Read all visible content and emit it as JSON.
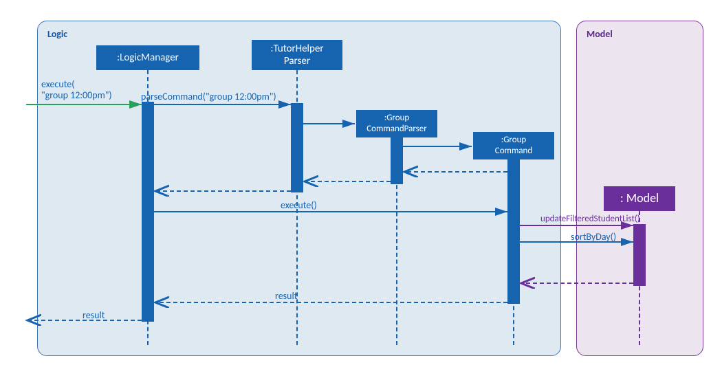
{
  "containers": {
    "logic_label": "Logic",
    "model_label": "Model"
  },
  "participants": {
    "logic_manager": ":LogicManager",
    "tutor_helper_parser": ":TutorHelper\nParser",
    "group_command_parser": ":Group\nCommandParser",
    "group_command": ":Group\nCommand",
    "model": ":   Model"
  },
  "messages": {
    "external_execute": "execute(\n\"group 12:00pm\")",
    "parse_command": "parseCommand(\"group 12:00pm\")",
    "execute": "execute()",
    "update_filtered": "updateFilteredStudentList()",
    "sort_by_day": "sortByDay()",
    "result_inner": "result",
    "result_outer": "result"
  },
  "chart_data": {
    "type": "uml_sequence_diagram",
    "title": "",
    "frames": [
      {
        "name": "Logic",
        "contains": [
          ":LogicManager",
          ":TutorHelperParser",
          ":GroupCommandParser",
          ":GroupCommand"
        ]
      },
      {
        "name": "Model",
        "contains": [
          ":Model"
        ]
      }
    ],
    "participants": [
      {
        "id": "external",
        "name": "(external caller)",
        "frame": null
      },
      {
        "id": "logic_manager",
        "name": ":LogicManager",
        "frame": "Logic"
      },
      {
        "id": "tutor_helper_parser",
        "name": ":TutorHelperParser",
        "frame": "Logic"
      },
      {
        "id": "group_command_parser",
        "name": ":GroupCommandParser",
        "frame": "Logic",
        "created_by": "tutor_helper_parser"
      },
      {
        "id": "group_command",
        "name": ":GroupCommand",
        "frame": "Logic",
        "created_by": "group_command_parser"
      },
      {
        "id": "model",
        "name": ":Model",
        "frame": "Model"
      }
    ],
    "messages": [
      {
        "from": "external",
        "to": "logic_manager",
        "label": "execute(\"group 12:00pm\")",
        "type": "call"
      },
      {
        "from": "logic_manager",
        "to": "tutor_helper_parser",
        "label": "parseCommand(\"group 12:00pm\")",
        "type": "call"
      },
      {
        "from": "tutor_helper_parser",
        "to": "group_command_parser",
        "label": "",
        "type": "create"
      },
      {
        "from": "group_command_parser",
        "to": "group_command",
        "label": "",
        "type": "create"
      },
      {
        "from": "group_command",
        "to": "group_command_parser",
        "label": "",
        "type": "return"
      },
      {
        "from": "group_command_parser",
        "to": "tutor_helper_parser",
        "label": "",
        "type": "return"
      },
      {
        "from": "tutor_helper_parser",
        "to": "logic_manager",
        "label": "",
        "type": "return"
      },
      {
        "from": "logic_manager",
        "to": "group_command",
        "label": "execute()",
        "type": "call"
      },
      {
        "from": "group_command",
        "to": "model",
        "label": "updateFilteredStudentList()",
        "type": "call"
      },
      {
        "from": "group_command",
        "to": "model",
        "label": "sortByDay()",
        "type": "call"
      },
      {
        "from": "model",
        "to": "group_command",
        "label": "",
        "type": "return"
      },
      {
        "from": "group_command",
        "to": "logic_manager",
        "label": "result",
        "type": "return"
      },
      {
        "from": "logic_manager",
        "to": "external",
        "label": "result",
        "type": "return"
      }
    ]
  }
}
